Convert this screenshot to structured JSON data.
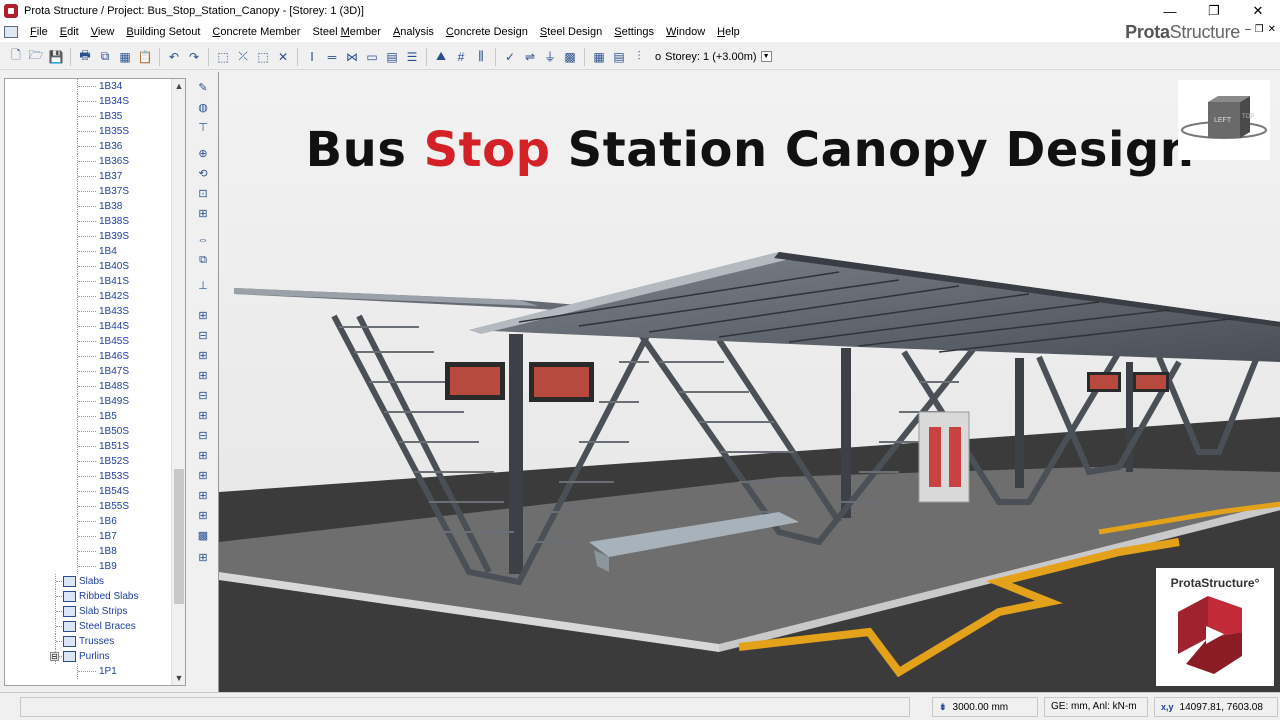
{
  "titlebar": {
    "title": "Prota Structure / Project: Bus_Stop_Station_Canopy - [Storey: 1 (3D)]",
    "minimize": "—",
    "restore": "❐",
    "close": "✕"
  },
  "menu": [
    {
      "pre": "",
      "ul": "F",
      "post": "ile"
    },
    {
      "pre": "",
      "ul": "E",
      "post": "dit"
    },
    {
      "pre": "",
      "ul": "V",
      "post": "iew"
    },
    {
      "pre": "",
      "ul": "B",
      "post": "uilding Setout"
    },
    {
      "pre": "",
      "ul": "C",
      "post": "oncrete Member"
    },
    {
      "pre": "Steel ",
      "ul": "M",
      "post": "ember"
    },
    {
      "pre": "",
      "ul": "A",
      "post": "nalysis"
    },
    {
      "pre": "",
      "ul": "C",
      "post": "oncrete Design"
    },
    {
      "pre": "",
      "ul": "S",
      "post": "teel Design"
    },
    {
      "pre": "",
      "ul": "S",
      "post": "ettings"
    },
    {
      "pre": "",
      "ul": "W",
      "post": "indow"
    },
    {
      "pre": "",
      "ul": "H",
      "post": "elp"
    }
  ],
  "brand": {
    "bold": "Prota",
    "light": "Structure"
  },
  "mdi_buttons": {
    "minimize": "–",
    "restore": "❐",
    "close": "✕"
  },
  "toolbar": {
    "storey_label": "Storey: 1 (+3.00m)",
    "icons": [
      "new-file-icon",
      "open-folder-icon",
      "save-icon",
      "print-icon",
      "copy-icon",
      "table-icon",
      "clipboard-icon",
      "undo-icon",
      "redo-icon",
      "select-icon",
      "select-cross-icon",
      "select-window-icon",
      "delete-icon",
      "column-icon",
      "beam-icon",
      "brace-icon",
      "slab-icon",
      "wall-icon",
      "layers-icon",
      "load-icon",
      "grid-icon",
      "storey-icon",
      "check-icon",
      "reinforcement-icon",
      "filter-icon",
      "mesh-icon",
      "grid-view-icon",
      "report-icon",
      "storey-menu-icon"
    ]
  },
  "tree": {
    "members": [
      "1B34",
      "1B34S",
      "1B35",
      "1B35S",
      "1B36",
      "1B36S",
      "1B37",
      "1B37S",
      "1B38",
      "1B38S",
      "1B39S",
      "1B4",
      "1B40S",
      "1B41S",
      "1B42S",
      "1B43S",
      "1B44S",
      "1B45S",
      "1B46S",
      "1B47S",
      "1B48S",
      "1B49S",
      "1B5",
      "1B50S",
      "1B51S",
      "1B52S",
      "1B53S",
      "1B54S",
      "1B55S",
      "1B6",
      "1B7",
      "1B8",
      "1B9"
    ],
    "categories": [
      {
        "label": "Slabs",
        "icon": "slab-icon"
      },
      {
        "label": "Ribbed Slabs",
        "icon": "ribbed-slab-icon"
      },
      {
        "label": "Slab Strips",
        "icon": "slab-strip-icon"
      },
      {
        "label": "Steel Braces",
        "icon": "steel-brace-icon"
      },
      {
        "label": "Trusses",
        "icon": "truss-icon"
      },
      {
        "label": "Purlins",
        "icon": "purlin-icon",
        "expanded": true
      }
    ],
    "purlins": [
      "1P1"
    ],
    "expander": "⊟",
    "scroll_up": "▲",
    "scroll_down": "▼"
  },
  "vertical_tools": [
    "pencil-icon",
    "sphere-icon",
    "axis-icon",
    "zoom-icon",
    "rotate-icon",
    "zoom-window-icon",
    "zoom-extents-icon",
    "pan-icon",
    "copy-view-icon",
    "section-icon",
    "storey-above-icon",
    "storey-below-icon",
    "storey-copy-icon",
    "storey-insert-icon",
    "storey-delete-icon",
    "storey-props-icon",
    "storey-list-icon",
    "storey-edit-icon",
    "storey-link-icon",
    "storey-lock-icon",
    "storey-grid-icon",
    "storey-color-icon",
    "storey-view-icon"
  ],
  "viewport": {
    "headline_a": "Bus ",
    "headline_b": "Stop",
    "headline_c": " Station Canopy Design",
    "viewcube_left": "LEFT",
    "viewcube_right": "TOP",
    "logo_text": "ProtaStructure°"
  },
  "statusbar": {
    "elevation": "3000.00 mm",
    "units": "GE: mm,  Anl: kN-m",
    "coord_label": "x,y",
    "coords": "14097.81, 7603.08"
  },
  "colors": {
    "accent_red": "#d42027",
    "tree_text": "#1f3f9f",
    "ground": "#3a3a3a",
    "canopy": "#6b7078"
  }
}
